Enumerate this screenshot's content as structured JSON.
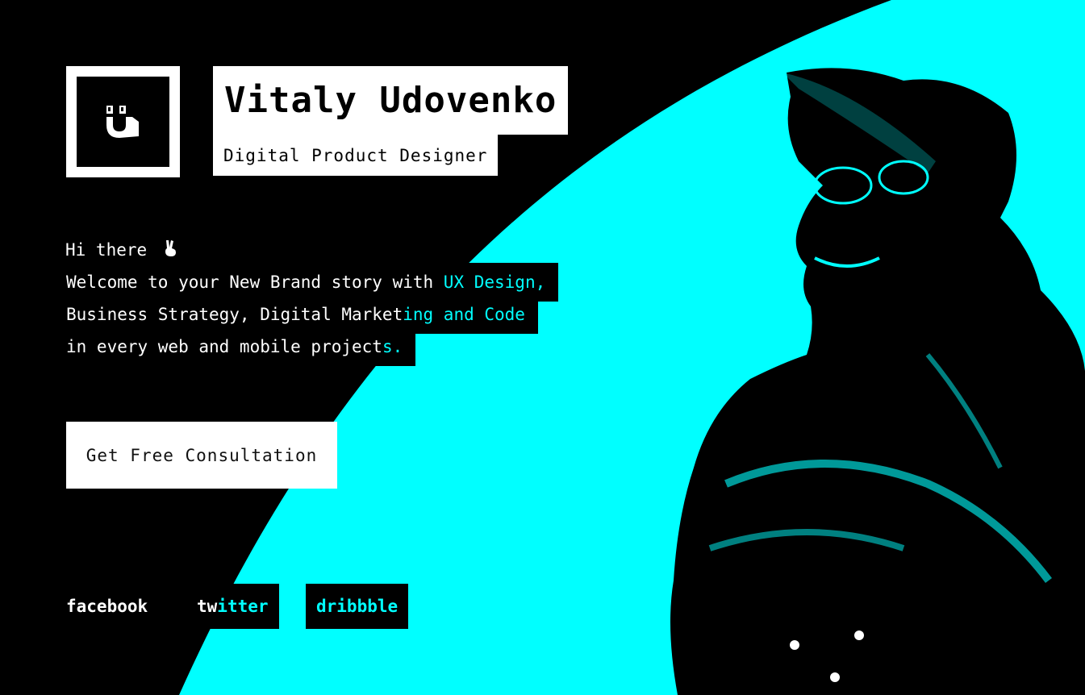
{
  "brand": {
    "name": "Vitaly Udovenko",
    "title": "Digital Product Designer",
    "logo_icon": "magnet-face-logo"
  },
  "intro": {
    "greeting": "Hi there",
    "greeting_icon": "victory-hand-emoji",
    "line1_a": "Welcome to your New Brand story with ",
    "line1_b": "UX Design,",
    "line2_a": "Business Strategy, Digital Market",
    "line2_b": "ing and Code",
    "line3_a": "in every web and mobile projec",
    "line3_b": "t",
    "line3_c": "s."
  },
  "cta": {
    "label": "Get Free Consultation"
  },
  "social": {
    "facebook": "facebook",
    "twitter_a": "tw",
    "twitter_b": "itter",
    "dribbble": "dribbble"
  },
  "colors": {
    "background": "#000000",
    "accent": "#00ffff",
    "panel": "#ffffff"
  }
}
